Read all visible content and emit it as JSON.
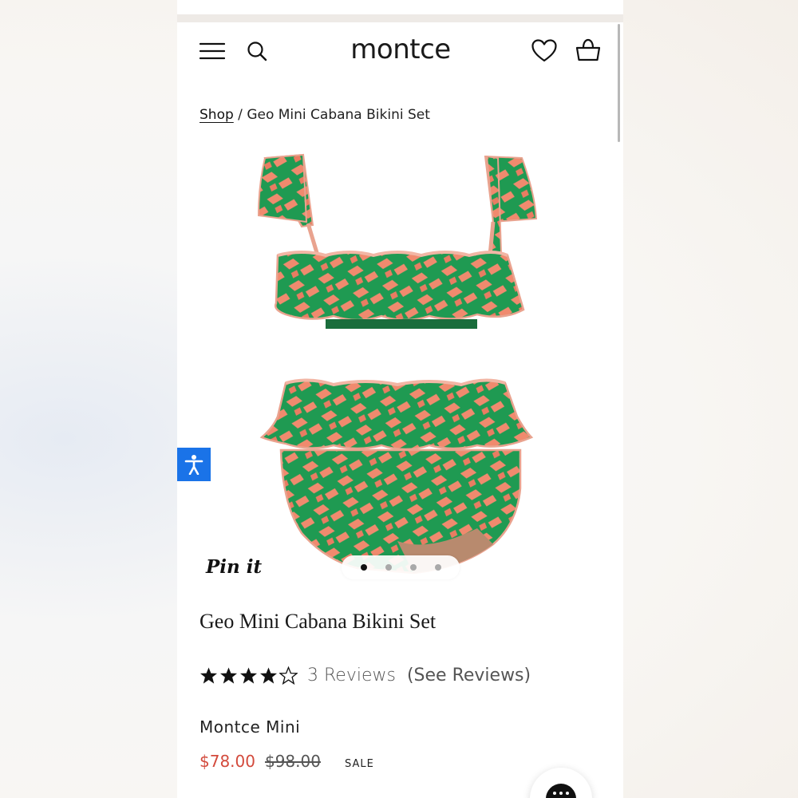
{
  "header": {
    "logo": "montce",
    "menu_icon": "hamburger-menu-icon",
    "search_icon": "search-icon",
    "wishlist_icon": "heart-icon",
    "cart_icon": "basket-icon"
  },
  "breadcrumb": {
    "shop": "Shop",
    "separator": " / ",
    "current": "Geo Mini Cabana Bikini Set"
  },
  "gallery": {
    "pin_label": "Pin it",
    "slide_count": 4,
    "active_slide": 1
  },
  "accessibility": {
    "icon": "accessibility-person-icon",
    "color": "#1a73e8"
  },
  "product": {
    "title": "Geo Mini Cabana Bikini Set",
    "rating": 4,
    "rating_max": 5,
    "reviews_label": "3 Reviews",
    "see_reviews_label": "(See Reviews)",
    "brand": "Montce Mini",
    "price_sale": "$78.00",
    "price_original": "$98.00",
    "sale_label": "SALE",
    "sale_color": "#d34a3c",
    "fabric_colors": {
      "green": "#1f9a52",
      "coral": "#f08a6e"
    }
  },
  "chat": {
    "icon": "chat-bubble-icon"
  }
}
